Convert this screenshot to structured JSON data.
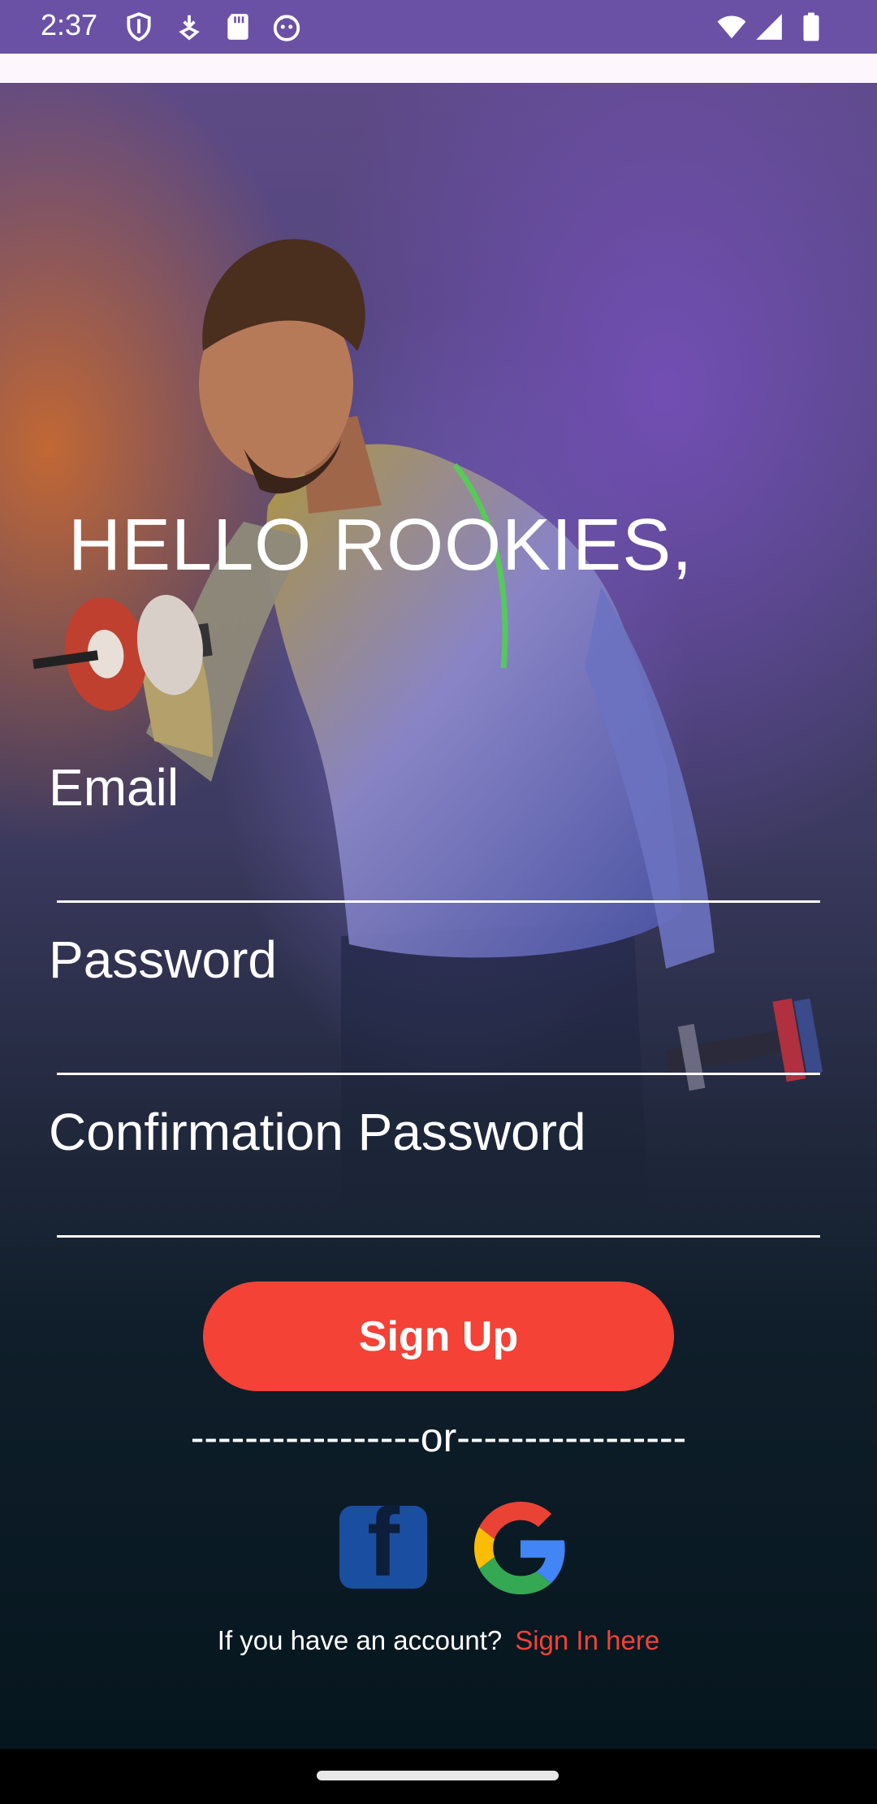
{
  "status_bar": {
    "time": "2:37",
    "left_icons": [
      "shield-icon",
      "download-icon",
      "sd-card-icon",
      "android-face-icon"
    ],
    "right_icons": [
      "wifi-icon",
      "signal-icon",
      "battery-icon"
    ]
  },
  "hero": {
    "headline": "HELLO ROOKIES,"
  },
  "form": {
    "email_label": "Email",
    "password_label": "Password",
    "confirm_label": "Confirmation Password",
    "email_value": "",
    "password_value": "",
    "confirm_value": ""
  },
  "actions": {
    "signup_label": "Sign Up",
    "divider_text": "-----------------or-----------------",
    "social": [
      "facebook-icon",
      "google-icon"
    ],
    "facebook_glyph": "f"
  },
  "footer": {
    "prompt": "If you have an account?",
    "signin_link": "Sign In here"
  },
  "colors": {
    "status_bar": "#6a51a6",
    "accent": "#f44236",
    "facebook": "#1a4ea0"
  }
}
